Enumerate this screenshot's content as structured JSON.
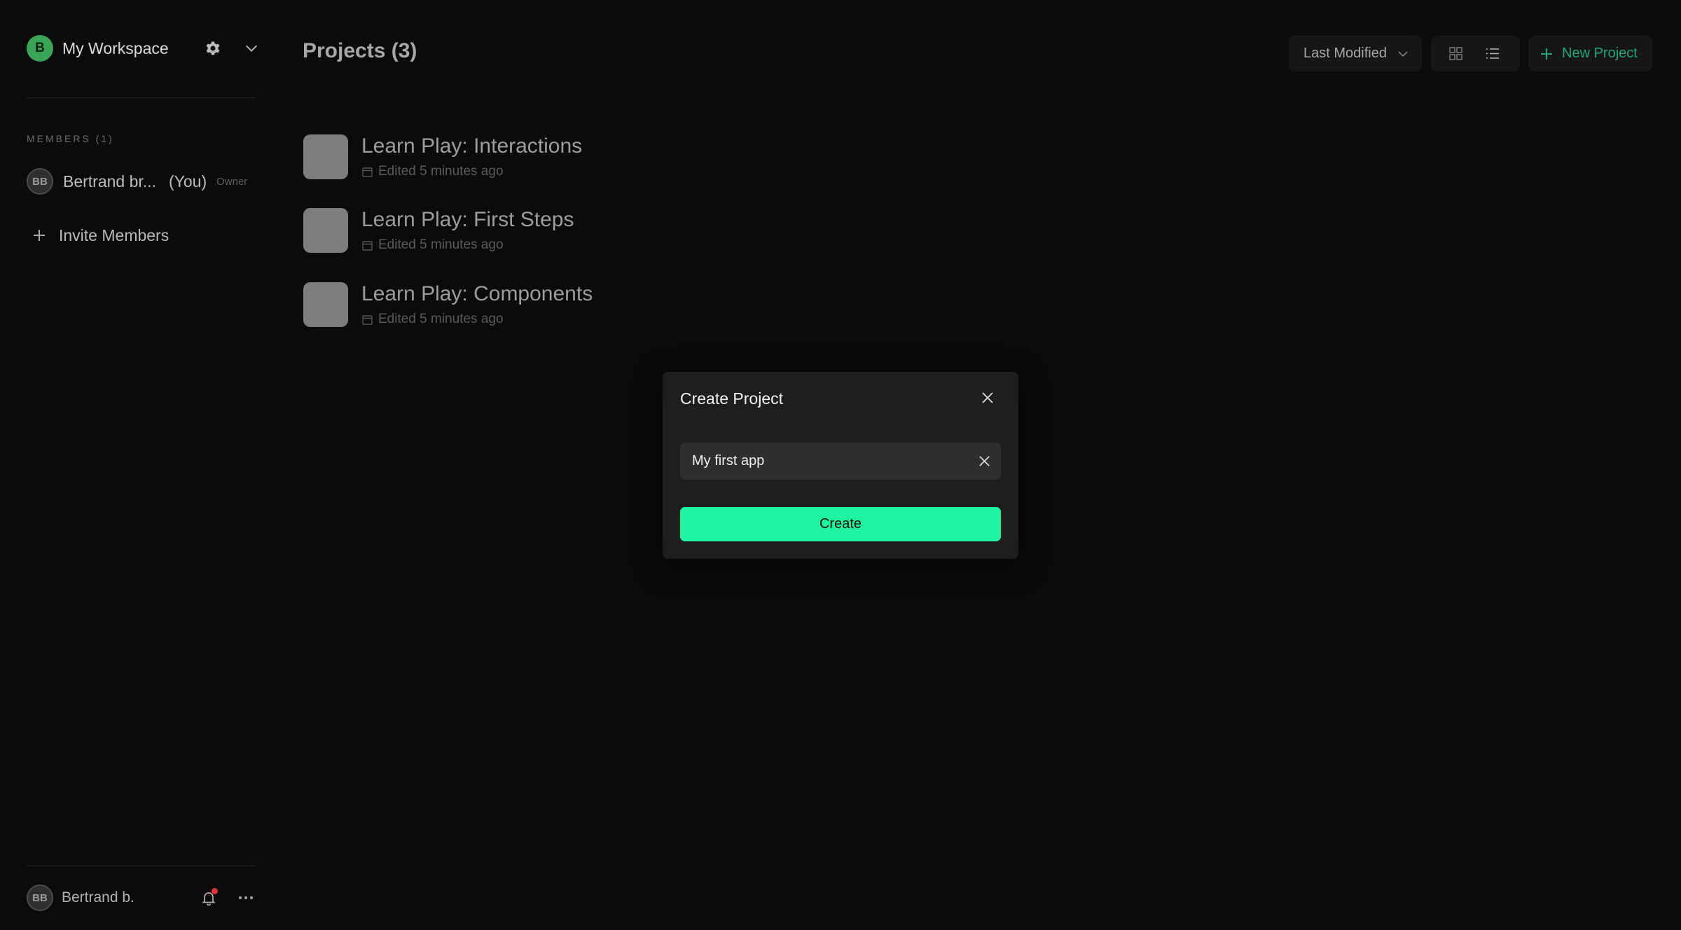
{
  "workspace": {
    "avatar_letter": "B",
    "name": "My Workspace"
  },
  "members": {
    "label": "MEMBERS (1)",
    "items": [
      {
        "initials": "BB",
        "name": "Bertrand br...",
        "you": "(You)",
        "role": "Owner"
      }
    ],
    "invite_label": "Invite Members"
  },
  "footer": {
    "initials": "BB",
    "name": "Bertrand b."
  },
  "main": {
    "title": "Projects (3)",
    "sort_label": "Last Modified",
    "new_project_label": "New Project",
    "projects": [
      {
        "title": "Learn Play: Interactions",
        "edited": "Edited 5 minutes ago"
      },
      {
        "title": "Learn Play: First Steps",
        "edited": "Edited 5 minutes ago"
      },
      {
        "title": "Learn Play: Components",
        "edited": "Edited 5 minutes ago"
      }
    ]
  },
  "modal": {
    "title": "Create Project",
    "input_value": "My first app",
    "create_label": "Create"
  },
  "colors": {
    "background": "#0b0b0b",
    "accent": "#1ff5a0",
    "new_project_text": "#1fa877",
    "workspace_avatar": "#3aa457",
    "notification_dot": "#e0303a"
  },
  "icons": {
    "settings": "gear-icon",
    "workspace_menu": "chevron-down-icon",
    "invite": "plus-icon",
    "notifications": "bell-icon",
    "more": "more-dots-icon",
    "grid_view": "grid-icon",
    "list_view": "list-icon",
    "close": "close-icon",
    "clear": "clear-icon",
    "calendar": "calendar-icon"
  }
}
